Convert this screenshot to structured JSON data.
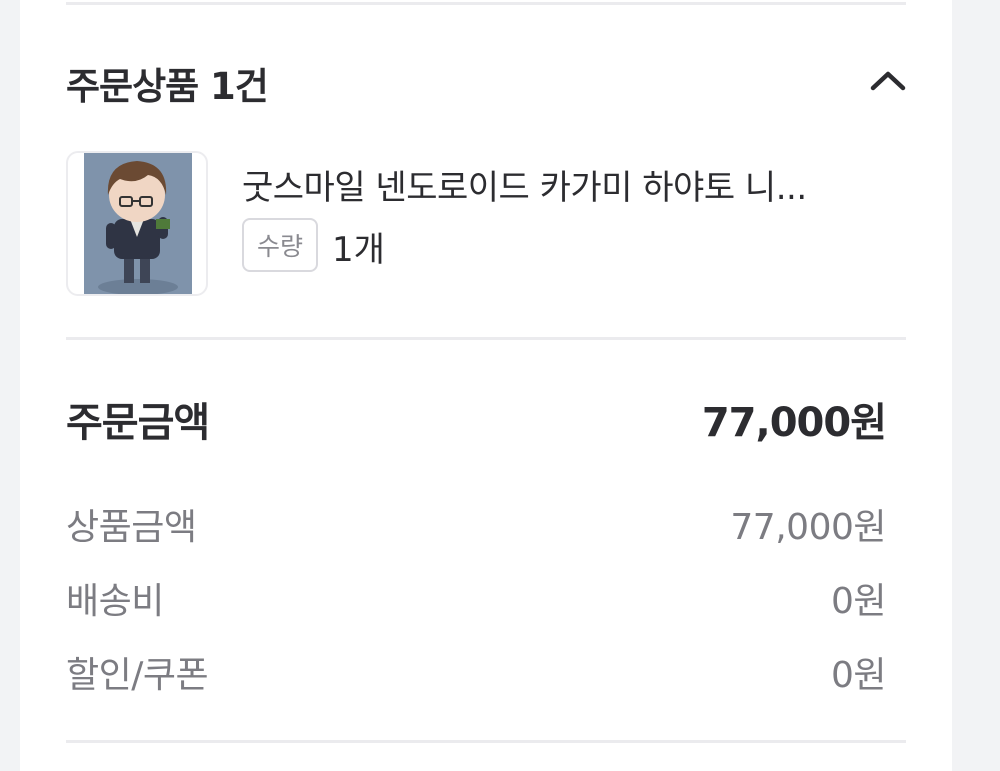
{
  "order_items": {
    "title": "주문상품 1건",
    "collapse_icon": "chevron-up-icon",
    "product": {
      "name": "굿스마일 넨도로이드 카가미 하야토 니...",
      "quantity_label": "수량",
      "quantity_value": "1개"
    }
  },
  "summary": {
    "total_label": "주문금액",
    "total_value": "77,000원",
    "rows": [
      {
        "label": "상품금액",
        "value": "77,000원"
      },
      {
        "label": "배송비",
        "value": "0원"
      },
      {
        "label": "할인/쿠폰",
        "value": "0원"
      }
    ]
  },
  "colors": {
    "text_primary": "#2c2c30",
    "text_secondary": "#7c7c82",
    "divider": "#ebebee",
    "page_background": "#f2f3f5"
  }
}
